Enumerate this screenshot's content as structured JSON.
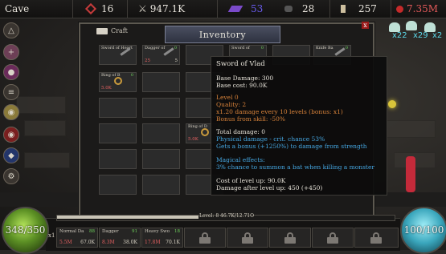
{
  "topbar": {
    "location": "Cave",
    "red_gems": "16",
    "damage": "947.1K",
    "purple_shards": "53",
    "ore": "28",
    "scrolls": "257",
    "gold": "7.35M"
  },
  "panel": {
    "title": "Inventory",
    "craft_label": "Craft",
    "close": "x"
  },
  "slots": [
    {
      "name": "Sword of Heart",
      "lvl": "",
      "stat": "",
      "stat2": ""
    },
    {
      "name": "Dagger of",
      "lvl": "0",
      "stat": "25",
      "stat2": "5"
    },
    {
      "name": "",
      "lvl": "",
      "stat": "",
      "stat2": ""
    },
    {
      "name": "Sword of",
      "lvl": "0",
      "stat": "",
      "stat2": ""
    },
    {
      "name": "",
      "lvl": "",
      "stat": "",
      "stat2": ""
    },
    {
      "name": "Knife Ba",
      "lvl": "0",
      "stat": "",
      "stat2": ""
    },
    {
      "name": "Ring of B",
      "lvl": "0",
      "stat": "5.0K",
      "stat2": ""
    },
    {
      "name": "Ring of D",
      "lvl": "0",
      "stat": "5.0K",
      "stat2": ""
    }
  ],
  "tooltip": {
    "title": "Sword of Vlad",
    "base_damage": "Base Damage: 300",
    "base_cost": "Base cost: 90.0K",
    "level": "Level 0",
    "quality": "Quality: 2",
    "bonus_line": "x1.20 damage every 10 levels (bonus: x1)",
    "skill_bonus": "Bonus from skill: -50%",
    "total_damage": "Total damage: 0",
    "crit": "Physical damage - crit. chance 53%",
    "strength": "Gets a bonus (+1250%) to damage from strength",
    "magic_title": "Magical effects:",
    "magic_effect": "3% chance to summon a bat when killing a monster",
    "cost_levelup": "Cost of level up: 90.0K",
    "damage_after": "Damage after level up: 450 (+450)"
  },
  "pets": {
    "count_1": "x22",
    "count_2": "x29",
    "count_3": "x2"
  },
  "orbs": {
    "health": "348/350",
    "mana": "100/100"
  },
  "xp": {
    "text": "Level: 8 46.7K/12.71O",
    "fill_fraction": 0.42
  },
  "hotbar": [
    {
      "name": "Normal Da",
      "lvl": "88",
      "stat": "5.5M",
      "stat2": "67.0K"
    },
    {
      "name": "Dagger",
      "lvl": "91",
      "stat": "8.3M",
      "stat2": "38.0K"
    },
    {
      "name": "Heavy Swo",
      "lvl": "18",
      "stat": "17.8M",
      "stat2": "70.1K"
    }
  ],
  "hotbar_multiplier": "x1",
  "colors": {
    "accent_gold": "#d7823a",
    "accent_blue": "#45a7e2",
    "level_green": "#6fd35c",
    "stat_red": "#e36060"
  }
}
